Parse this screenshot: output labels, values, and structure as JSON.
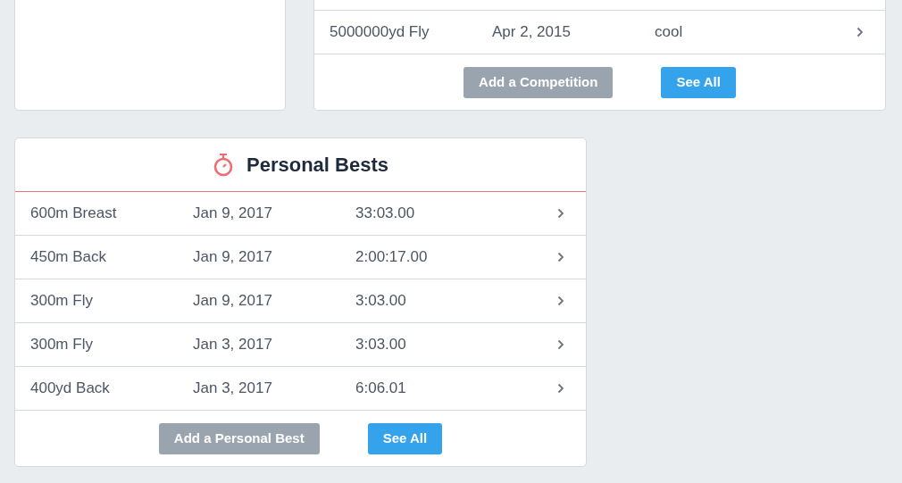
{
  "competitions": {
    "rows": [
      {
        "event": "5000000yd Fly",
        "date": "Apr 2, 2015",
        "note": "cool"
      }
    ],
    "buttons": [
      {
        "label": "Add a Competition",
        "kind": "secondary"
      },
      {
        "label": "See All",
        "kind": "primary"
      }
    ]
  },
  "personal_bests": {
    "title": "Personal Bests",
    "rows": [
      {
        "event": "600m Breast",
        "date": "Jan 9, 2017",
        "time": "33:03.00"
      },
      {
        "event": "450m Back",
        "date": "Jan 9, 2017",
        "time": "2:00:17.00"
      },
      {
        "event": "300m Fly",
        "date": "Jan 9, 2017",
        "time": "3:03.00"
      },
      {
        "event": "300m Fly",
        "date": "Jan 3, 2017",
        "time": "3:03.00"
      },
      {
        "event": "400yd Back",
        "date": "Jan 3, 2017",
        "time": "6:06.01"
      }
    ],
    "buttons": [
      {
        "label": "Add a Personal Best",
        "kind": "secondary"
      },
      {
        "label": "See All",
        "kind": "primary"
      }
    ]
  }
}
